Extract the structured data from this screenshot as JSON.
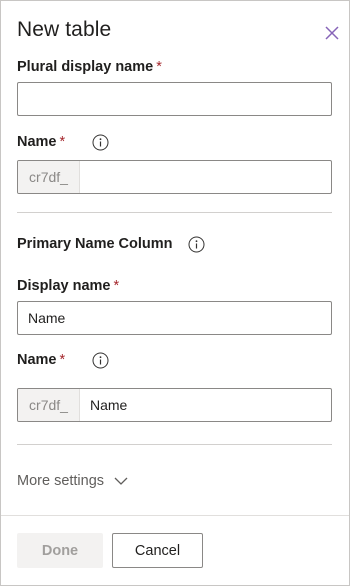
{
  "panel": {
    "title": "New table",
    "close_icon": "close-icon"
  },
  "plural_display_name": {
    "label": "Plural display name",
    "required_mark": "*",
    "value": ""
  },
  "table_name": {
    "label": "Name",
    "required_mark": "*",
    "info_icon": "info-icon",
    "prefix": "cr7df_",
    "value": ""
  },
  "primary_column": {
    "heading": "Primary Name Column",
    "info_icon": "info-icon"
  },
  "display_name": {
    "label": "Display name",
    "required_mark": "*",
    "value": "Name"
  },
  "column_name": {
    "label": "Name",
    "required_mark": "*",
    "info_icon": "info-icon",
    "prefix": "cr7df_",
    "value": "Name"
  },
  "more_settings": {
    "label": "More settings",
    "icon": "chevron-down-icon"
  },
  "footer": {
    "done_label": "Done",
    "cancel_label": "Cancel"
  },
  "colors": {
    "accent": "#8764b8",
    "required": "#a4262c",
    "border": "#8a8886",
    "disabled_bg": "#f3f2f1"
  }
}
